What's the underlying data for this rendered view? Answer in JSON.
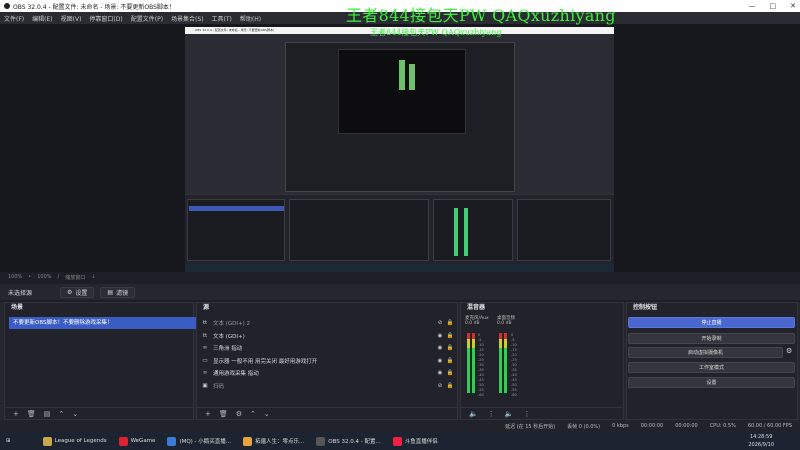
{
  "window": {
    "title": "OBS 32.0.4 - 配置文件: 未命名 - 场景: 不要更新OBS脚本！",
    "minimize": "—",
    "maximize": "□",
    "close": "✕"
  },
  "menu": [
    "文件(F)",
    "编辑(E)",
    "视图(V)",
    "停靠窗口(D)",
    "配置文件(P)",
    "场景集合(S)",
    "工具(T)",
    "帮助(H)"
  ],
  "watermark": "王者844接包天PW QAQxuzhiyang",
  "preview": {
    "inner_title": "OBS 32.0.4 - 配置文件: 未命名 - 场景: 不要更新OBS脚本！",
    "inner_watermark": "王者844接包天PW QAQxuzhiyang"
  },
  "zoom_row": [
    "100%",
    "•",
    "100%",
    "/",
    "缩放窗口",
    "↓"
  ],
  "source_bar": {
    "none_selected": "未选择源",
    "properties": "设置",
    "filters": "滤镜"
  },
  "scenes": {
    "header": "场景",
    "items": [
      "不要更新OBS脚本！不要删除游戏采集！"
    ]
  },
  "sources": {
    "header": "源",
    "items": [
      {
        "icon": "tt",
        "label": "文本 (GDI+) 2",
        "hidden": true
      },
      {
        "icon": "tt",
        "label": "文本 (GDI+)",
        "hidden": false
      },
      {
        "icon": "∞",
        "label": "三角洲 指动",
        "hidden": false
      },
      {
        "icon": "▭",
        "label": "显示器 一般不用 用完关闭 最好用游戏打开",
        "hidden": false
      },
      {
        "icon": "∞",
        "label": "通用游戏采集 指动",
        "hidden": false
      },
      {
        "icon": "▣",
        "label": "扫码",
        "hidden": true
      }
    ]
  },
  "mixer": {
    "header": "混音器",
    "channels": [
      {
        "name": "麦克风/Aux",
        "level": "0.0 dB"
      },
      {
        "name": "桌面音频",
        "level": "0.0 dB"
      }
    ],
    "ticks": [
      "0",
      "-5",
      "-10",
      "-15",
      "-20",
      "-25",
      "-30",
      "-35",
      "-40",
      "-45",
      "-50",
      "-55",
      "-60"
    ]
  },
  "controls": {
    "header": "控制按钮",
    "buttons": [
      "停止直播",
      "开始录制",
      "启动虚拟摄像机",
      "工作室模式",
      "设置"
    ]
  },
  "status": {
    "delay": "延迟 (在 15 秒后开始)",
    "dropped": "丢帧 0 (0.0%)",
    "bitrate": "0 kbps",
    "live_time": "00:00:00",
    "rec_time": "00:00:00",
    "cpu": "CPU: 0.5%",
    "fps": "60.00 / 60.00 FPS"
  },
  "taskbar": {
    "apps": [
      {
        "label": "League of Legends",
        "color": "#c8a84a"
      },
      {
        "label": "WeGame",
        "color": "#d23"
      },
      {
        "label": "(MQ) - 小鹅买直播...",
        "color": "#3a7bd5"
      },
      {
        "label": "拓疆人生：零点乐...",
        "color": "#e6a23c"
      },
      {
        "label": "OBS 32.0.4 - 配置...",
        "color": "#555"
      },
      {
        "label": "斗鱼直播伴侣",
        "color": "#e24"
      }
    ],
    "time": "14:28:59",
    "date": "2026/9/10"
  }
}
